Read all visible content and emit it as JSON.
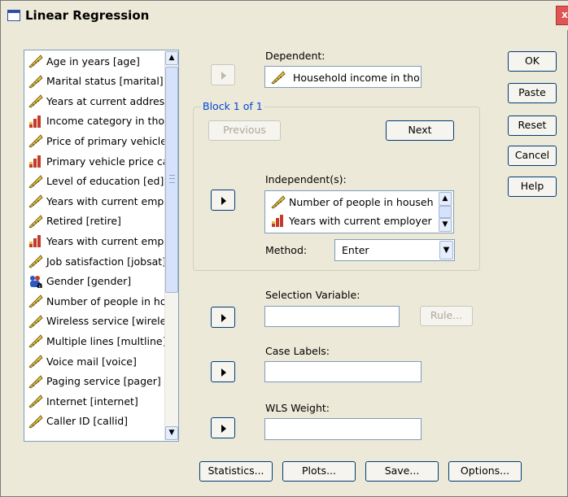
{
  "window": {
    "title": "Linear Regression",
    "close_glyph": "x"
  },
  "variables": [
    {
      "label": "Age in years [age]",
      "icon": "scale-ruler-icon"
    },
    {
      "label": "Marital status [marital]",
      "icon": "scale-ruler-icon"
    },
    {
      "label": "Years at current address [address]",
      "icon": "scale-ruler-icon"
    },
    {
      "label": "Income category in thousands [inccat]",
      "icon": "ordinal-bars-icon"
    },
    {
      "label": "Price of primary vehicle [carcat]",
      "icon": "scale-ruler-icon"
    },
    {
      "label": "Primary vehicle price category [carcat]",
      "icon": "ordinal-bars-icon"
    },
    {
      "label": "Level of education [ed]",
      "icon": "scale-ruler-icon"
    },
    {
      "label": "Years with current employer [employ]",
      "icon": "scale-ruler-icon"
    },
    {
      "label": "Retired [retire]",
      "icon": "scale-ruler-icon"
    },
    {
      "label": "Years with current employer [empcat]",
      "icon": "ordinal-bars-icon"
    },
    {
      "label": "Job satisfaction [jobsat]",
      "icon": "scale-ruler-icon"
    },
    {
      "label": "Gender [gender]",
      "icon": "nominal-a-icon"
    },
    {
      "label": "Number of people in household",
      "icon": "scale-ruler-icon"
    },
    {
      "label": "Wireless service [wireless]",
      "icon": "scale-ruler-icon"
    },
    {
      "label": "Multiple lines [multline]",
      "icon": "scale-ruler-icon"
    },
    {
      "label": "Voice mail [voice]",
      "icon": "scale-ruler-icon"
    },
    {
      "label": "Paging service [pager]",
      "icon": "scale-ruler-icon"
    },
    {
      "label": "Internet [internet]",
      "icon": "scale-ruler-icon"
    },
    {
      "label": "Caller ID [callid]",
      "icon": "scale-ruler-icon"
    }
  ],
  "dependent": {
    "label": "Dependent:",
    "value": "Household income in thousands"
  },
  "block": {
    "label": "Block 1 of 1",
    "previous": "Previous",
    "next": "Next",
    "independents_label": "Independent(s):",
    "independents": [
      {
        "label": "Number of people in household",
        "icon": "scale-ruler-icon"
      },
      {
        "label": "Years with current employer",
        "icon": "ordinal-bars-icon"
      }
    ],
    "method_label": "Method:",
    "method_value": "Enter"
  },
  "selection": {
    "label": "Selection Variable:",
    "rule": "Rule..."
  },
  "case_labels": {
    "label": "Case Labels:"
  },
  "wls": {
    "label": "WLS Weight:"
  },
  "side_buttons": {
    "ok": "OK",
    "paste": "Paste",
    "reset": "Reset",
    "cancel": "Cancel",
    "help": "Help"
  },
  "bottom_buttons": {
    "statistics": "Statistics...",
    "plots": "Plots...",
    "save": "Save...",
    "options": "Options..."
  },
  "colors": {
    "dialog_bg": "#ece9d8",
    "group_label": "#0046d5",
    "control_border": "#003c74"
  }
}
